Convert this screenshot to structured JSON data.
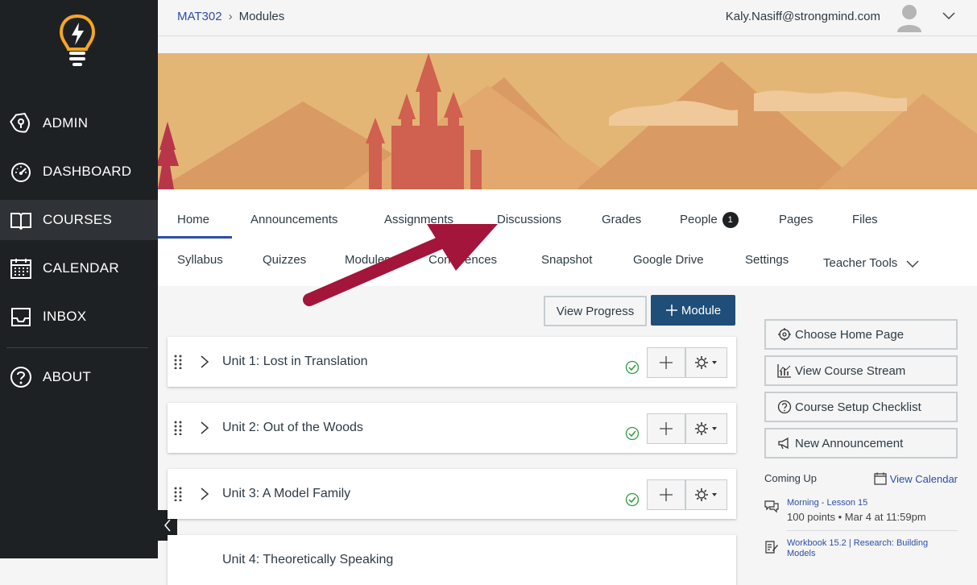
{
  "sidebar": {
    "items": [
      {
        "label": "ADMIN",
        "icon": "admin-shield-icon"
      },
      {
        "label": "DASHBOARD",
        "icon": "dashboard-gauge-icon"
      },
      {
        "label": "COURSES",
        "icon": "book-icon"
      },
      {
        "label": "CALENDAR",
        "icon": "calendar-icon"
      },
      {
        "label": "INBOX",
        "icon": "inbox-icon"
      },
      {
        "label": "ABOUT",
        "icon": "help-icon"
      }
    ],
    "active": "COURSES"
  },
  "breadcrumb": {
    "course": "MAT302",
    "page": "Modules"
  },
  "user": {
    "email": "Kaly.Nasiff@strongmind.com"
  },
  "tabs": {
    "row1": [
      "Home",
      "Announcements",
      "Assignments",
      "Discussions",
      "Grades",
      "People",
      "Pages",
      "Files"
    ],
    "row2": [
      "Syllabus",
      "Quizzes",
      "Modules",
      "Conferences",
      "Snapshot",
      "Google Drive",
      "Settings",
      "Teacher Tools"
    ],
    "people_badge": "1",
    "active": "Home"
  },
  "actions": {
    "view_progress": "View Progress",
    "add_module": "Module"
  },
  "modules": [
    {
      "title": "Unit 1: Lost in Translation"
    },
    {
      "title": "Unit 2: Out of the Woods"
    },
    {
      "title": "Unit 3: A Model Family"
    },
    {
      "title": "Unit 4: Theoretically Speaking"
    }
  ],
  "side_buttons": [
    "Choose Home Page",
    "View Course Stream",
    "Course Setup Checklist",
    "New Announcement"
  ],
  "coming_up": {
    "heading": "Coming Up",
    "view_calendar": "View Calendar",
    "events": [
      {
        "title": "Morning - Lesson 15",
        "meta": "100 points • Mar 4 at 11:59pm"
      },
      {
        "title": "Workbook 15.2 | Research: Building Models",
        "meta": ""
      }
    ]
  },
  "colors": {
    "sidebar": "#1e2124",
    "accent": "#2b4ea8",
    "primary_button": "#1f4e79",
    "arrow": "#a3153a",
    "banner": "#e3b676"
  }
}
